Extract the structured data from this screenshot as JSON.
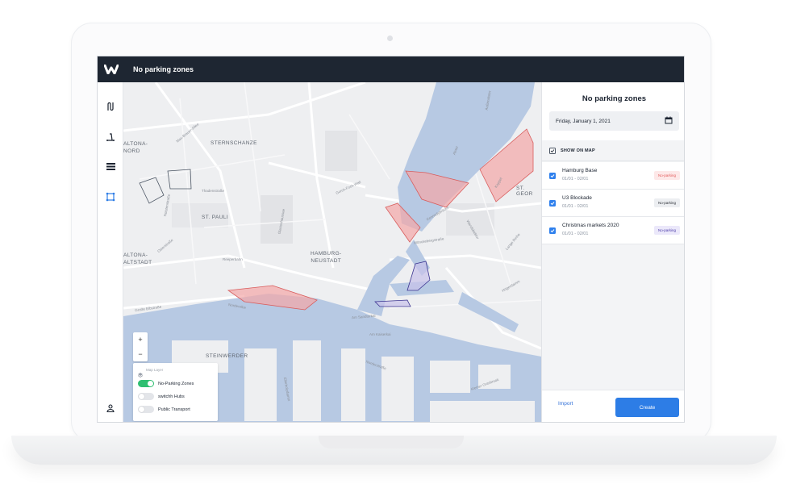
{
  "topbar": {
    "title": "No parking zones",
    "logo_icon": "w-logo-icon"
  },
  "sidebar": {
    "items": [
      "route-icon",
      "scooter-icon",
      "list-icon",
      "zones-icon"
    ],
    "footer": "user-icon"
  },
  "map": {
    "districts": [
      "STERNSCHANZE",
      "ST. PAULI",
      "ALTONA-\nNORD",
      "ALTONA-\nALTSTADT",
      "HAMBURG-\nNEUSTADT",
      "STEINWERDER",
      "ST. GEOR"
    ],
    "streets": [
      "Max-Brauer-Allee",
      "Holstenstraße",
      "Thadenstraße",
      "Reeperbahn",
      "Große Elbstraße",
      "Glacischaussee",
      "Gorch-Fock-Wall",
      "Mönckebergstraße",
      "Am Sandtorkai",
      "Am Kaiserkai",
      "Wandsbektor",
      "Högerdamm",
      "Norderelbe",
      "Kennedybrücke",
      "Ellerholzdamm",
      "Außenalster",
      "Alster",
      "Koppel",
      "Osterstraße",
      "Kleiner Grasbrook",
      "Lange Reihe",
      "Norderstraße"
    ],
    "zoom": {
      "plus": "+",
      "minus": "−"
    },
    "layers": {
      "title": "Map Layer",
      "items": [
        {
          "label": "No-Parking Zones",
          "on": true
        },
        {
          "label": "switchh Hubs",
          "on": false
        },
        {
          "label": "Public Transport",
          "on": false
        }
      ]
    }
  },
  "panel": {
    "title": "No parking zones",
    "date": "Friday, January 1, 2021",
    "show_on_map": "SHOW ON MAP",
    "zones": [
      {
        "name": "Hamburg Base",
        "dates": "01/01 - 02/01",
        "badge": "No-parking",
        "badge_color": "#e25a5a"
      },
      {
        "name": "U3 Blockade",
        "dates": "01/01 - 02/01",
        "badge": "No-parking",
        "badge_color": "#2b2f36"
      },
      {
        "name": "Christmas markets 2020",
        "dates": "01/01 - 02/01",
        "badge": "No-parking",
        "badge_color": "#4a3aa8"
      }
    ],
    "import_label": "Import",
    "create_label": "Create"
  },
  "colors": {
    "accent": "#2d7de6",
    "topbar": "#1e2632",
    "water": "#b7c9e3",
    "zone_red": "#f4a6a6"
  }
}
